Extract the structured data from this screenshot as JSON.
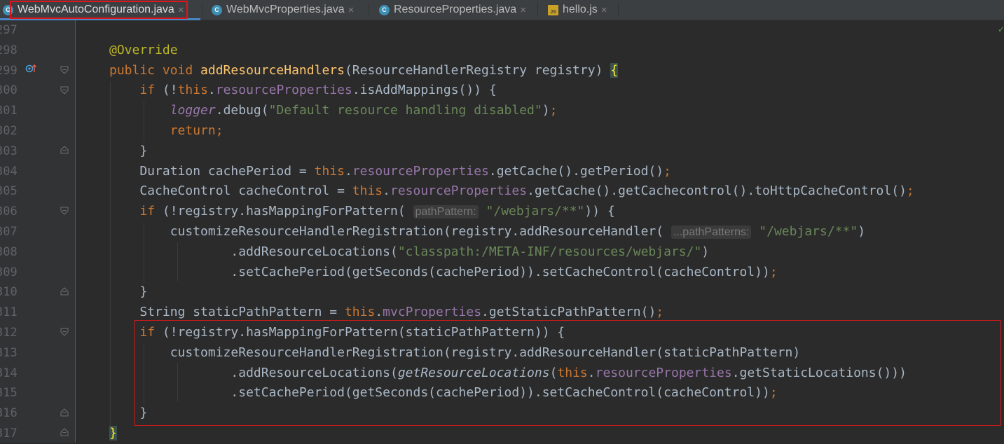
{
  "tabs": [
    {
      "label": "WebMvcAutoConfiguration.java",
      "icon": "java-class-icon",
      "active": true
    },
    {
      "label": "WebMvcProperties.java",
      "icon": "java-class-icon",
      "active": false
    },
    {
      "label": "ResourceProperties.java",
      "icon": "java-class-icon",
      "active": false
    },
    {
      "label": "hello.js",
      "icon": "javascript-file-icon",
      "active": false
    }
  ],
  "tab_icon_text": {
    "java": "C",
    "js": "JS"
  },
  "tab_close": "×",
  "colors": {
    "keyword": "#cc7832",
    "annotation": "#bbb529",
    "method_decl": "#ffc66d",
    "field": "#9876aa",
    "string": "#6a8759",
    "plain": "#a9b7c6",
    "highlight_border": "#e0141a",
    "background": "#2b2b2b"
  },
  "editor": {
    "lines": [
      {
        "number": "297",
        "text": ""
      },
      {
        "number": "298",
        "text": "@Override"
      },
      {
        "number": "299",
        "text": "public void addResourceHandlers(ResourceHandlerRegistry registry) {"
      },
      {
        "number": "300",
        "text": "if (!this.resourceProperties.isAddMappings()) {"
      },
      {
        "number": "301",
        "text": "logger.debug(\"Default resource handling disabled\");"
      },
      {
        "number": "302",
        "text": "return;"
      },
      {
        "number": "303",
        "text": "}"
      },
      {
        "number": "304",
        "text": "Duration cachePeriod = this.resourceProperties.getCache().getPeriod();"
      },
      {
        "number": "305",
        "text": "CacheControl cacheControl = this.resourceProperties.getCache().getCachecontrol().toHttpCacheControl();"
      },
      {
        "number": "306",
        "text": "if (!registry.hasMappingForPattern( pathPattern: \"/webjars/**\")) {"
      },
      {
        "number": "307",
        "text": "customizeResourceHandlerRegistration(registry.addResourceHandler( ...pathPatterns: \"/webjars/**\")"
      },
      {
        "number": "308",
        "text": ".addResourceLocations(\"classpath:/META-INF/resources/webjars/\")"
      },
      {
        "number": "309",
        "text": ".setCachePeriod(getSeconds(cachePeriod)).setCacheControl(cacheControl));"
      },
      {
        "number": "310",
        "text": "}"
      },
      {
        "number": "311",
        "text": "String staticPathPattern = this.mvcProperties.getStaticPathPattern();"
      },
      {
        "number": "312",
        "text": "if (!registry.hasMappingForPattern(staticPathPattern)) {"
      },
      {
        "number": "313",
        "text": "customizeResourceHandlerRegistration(registry.addResourceHandler(staticPathPattern)"
      },
      {
        "number": "314",
        "text": ".addResourceLocations(getResourceLocations(this.resourceProperties.getStaticLocations()))"
      },
      {
        "number": "315",
        "text": ".setCachePeriod(getSeconds(cachePeriod)).setCacheControl(cacheControl));"
      },
      {
        "number": "316",
        "text": "}"
      },
      {
        "number": "317",
        "text": "}"
      }
    ]
  }
}
